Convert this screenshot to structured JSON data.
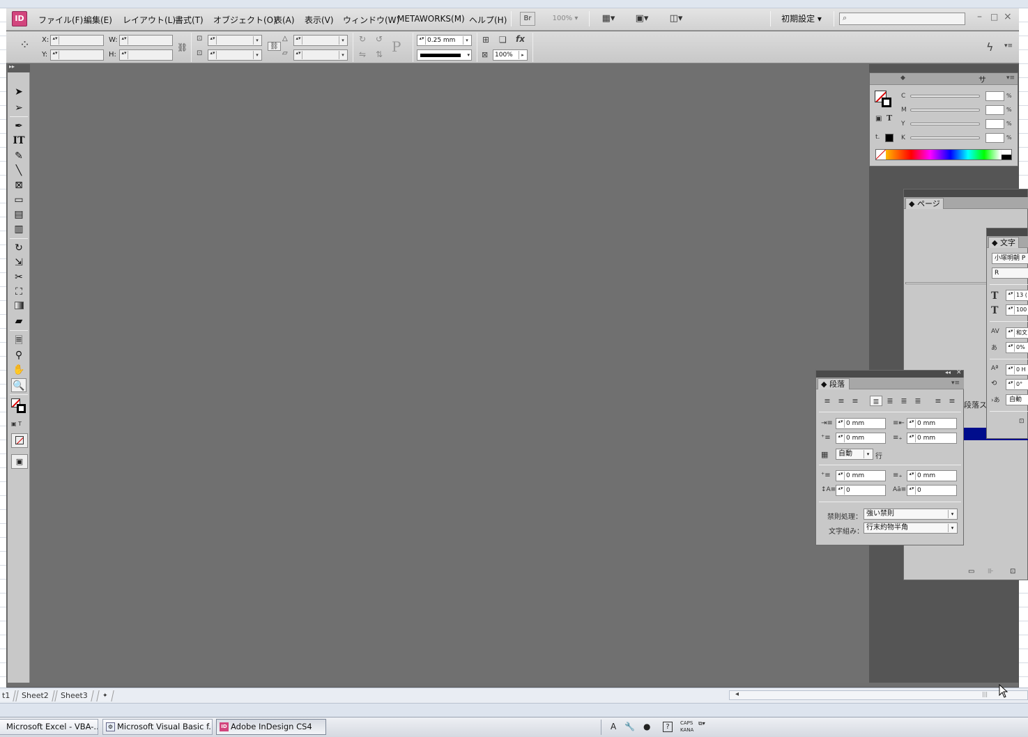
{
  "menubar": {
    "logo": "ID",
    "menus": [
      "ファイル(F)",
      "編集(E)",
      "レイアウト(L)",
      "書式(T)",
      "オブジェクト(O)",
      "表(A)",
      "表示(V)",
      "ウィンドウ(W)",
      "METAWORKS(M)",
      "ヘルプ(H)"
    ],
    "bridge": "Br",
    "zoom": "100%",
    "workspace": "初期設定",
    "search_placeholder": ""
  },
  "control": {
    "x_label": "X:",
    "y_label": "Y:",
    "w_label": "W:",
    "h_label": "H:",
    "stroke_weight": "0.25 mm",
    "opacity": "100%",
    "fx": "fx"
  },
  "tools": {
    "icons": [
      "selection-tool",
      "direct-selection-tool",
      "pen-tool",
      "type-tool",
      "pencil-tool",
      "line-tool",
      "rectangle-frame-tool",
      "rectangle-tool",
      "horizontal-grid-tool",
      "vertical-grid-tool",
      "rotate-tool",
      "scale-tool",
      "scissors-tool",
      "free-transform-tool",
      "gradient-tool",
      "gradient-feather-tool",
      "note-tool",
      "eyedropper-tool",
      "hand-tool",
      "zoom-tool"
    ]
  },
  "color_panel": {
    "channels": [
      "C",
      "M",
      "Y",
      "K"
    ],
    "units": "%",
    "tab_right": "サ"
  },
  "pages_panel": {
    "tab": "ページ"
  },
  "char_panel": {
    "tab": "文字",
    "font": "小塚明朝 P",
    "style": "R",
    "size": "13 (",
    "scale": "100",
    "kerning": "和文",
    "tracking": "0%",
    "shift": "0 H",
    "skew": "0°",
    "leading": "自動"
  },
  "para_panel": {
    "tab": "段落",
    "left_indent": "0 mm",
    "right_indent": "0 mm",
    "first_indent": "0 mm",
    "last_indent": "0 mm",
    "grid": "自動",
    "grid_unit": "行",
    "space_before": "0 mm",
    "space_after": "0 mm",
    "drop_lines": "0",
    "drop_chars": "0",
    "kinsoku_label": "禁則処理：",
    "kinsoku_value": "強い禁則",
    "mojikumi_label": "文字組み：",
    "mojikumi_value": "行末約物半角",
    "behind_label": "段落ス"
  },
  "excel": {
    "sheets": [
      "t1",
      "Sheet2",
      "Sheet3"
    ]
  },
  "taskbar": {
    "items": [
      "Microsoft Excel - VBA-...",
      "Microsoft Visual Basic f...",
      "Adobe InDesign CS4"
    ],
    "caps": "CAPS",
    "kana": "KANA"
  }
}
